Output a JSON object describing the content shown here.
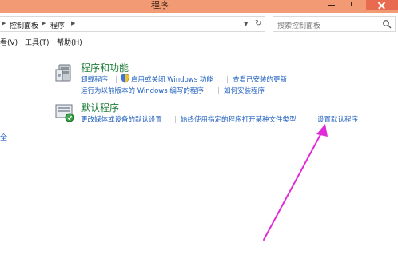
{
  "window": {
    "title": "程序"
  },
  "address": {
    "breadcrumb": [
      "控制面板",
      "程序"
    ]
  },
  "search": {
    "placeholder": "搜索控制面板"
  },
  "menu": [
    "看(V)",
    "工具(T)",
    "帮助(H)"
  ],
  "sections": [
    {
      "title": "程序和功能",
      "icon": "programs-and-features-icon",
      "links_row1": [
        "卸载程序",
        "启用或关闭 Windows 功能",
        "查看已安装的更新"
      ],
      "links_row2": [
        "运行为以前版本的 Windows 编写的程序",
        "如何安装程序"
      ]
    },
    {
      "title": "默认程序",
      "icon": "default-programs-icon",
      "links_row1": [
        "更改媒体或设备的默认设置",
        "始终使用指定的程序打开某种文件类型",
        "设置默认程序"
      ]
    }
  ],
  "left_pane": {
    "partial_text": "全"
  },
  "annotation": {
    "arrow_color": "#e22bd8"
  }
}
